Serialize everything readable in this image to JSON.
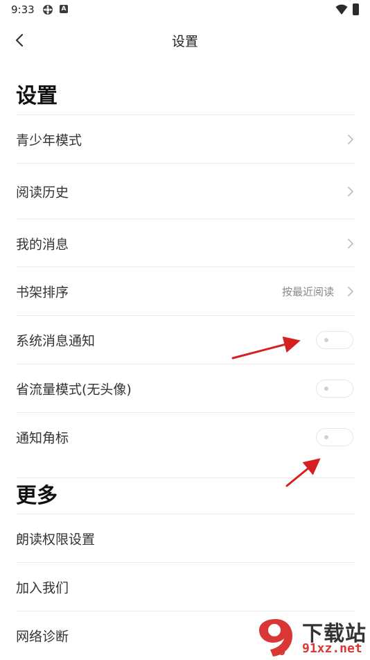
{
  "status_bar": {
    "time": "9:33",
    "icons": [
      "settings-gear-icon",
      "a-box-icon",
      "wifi-icon",
      "battery-icon"
    ],
    "a_icon_glyph": "A"
  },
  "nav": {
    "back_icon": "chevron-left-icon",
    "title": "设置"
  },
  "sections": [
    {
      "header": "设置",
      "items": [
        {
          "label": "青少年模式",
          "control": "chevron"
        },
        {
          "label": "阅读历史",
          "control": "chevron"
        },
        {
          "label": "我的消息",
          "control": "chevron"
        },
        {
          "label": "书架排序",
          "value": "按最近阅读",
          "control": "chevron"
        },
        {
          "label": "系统消息通知",
          "control": "toggle",
          "on": false
        },
        {
          "label": "省流量模式(无头像)",
          "control": "toggle",
          "on": false
        },
        {
          "label": "通知角标",
          "control": "toggle",
          "on": false
        }
      ]
    },
    {
      "header": "更多",
      "items": [
        {
          "label": "朗读权限设置"
        },
        {
          "label": "加入我们"
        },
        {
          "label": "网络诊断"
        }
      ]
    }
  ],
  "annotation_color": "#d42020",
  "watermark": {
    "logo_text": "9",
    "text_top": "下载站",
    "text_bottom": "91xz.net",
    "accent_color": "#d93636"
  }
}
